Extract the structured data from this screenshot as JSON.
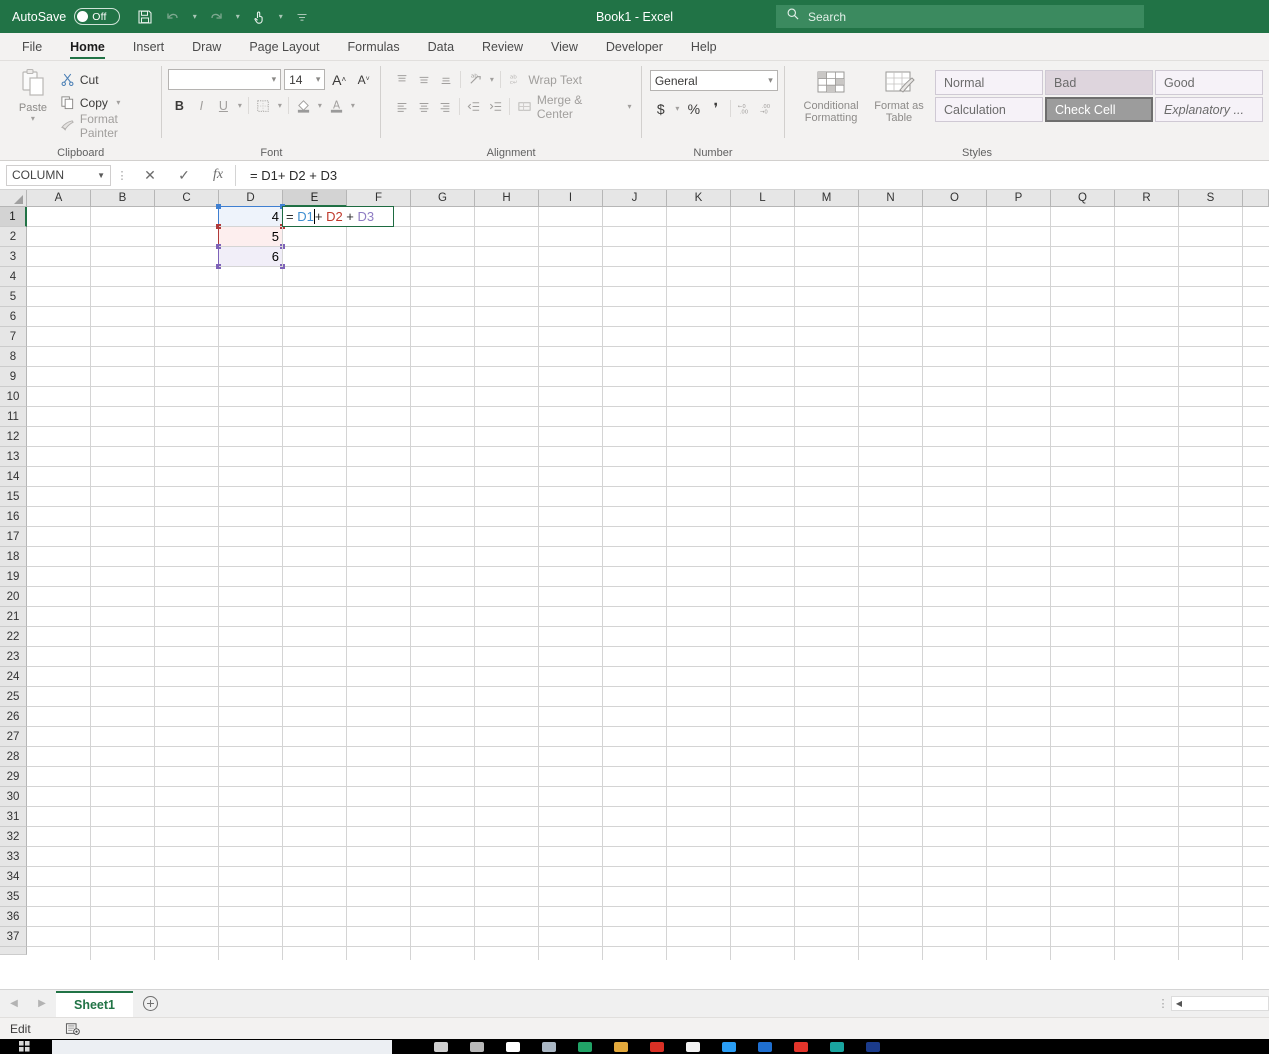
{
  "titlebar": {
    "autosave_label": "AutoSave",
    "autosave_state": "Off",
    "save_icon": "save-icon",
    "undo_icon": "undo-icon",
    "redo_icon": "redo-icon",
    "touch_icon": "touch-mode-icon",
    "customize_icon": "customize-quick-access-toolbar-icon",
    "title": "Book1  -  Excel",
    "search_placeholder": "Search",
    "search_icon": "search-icon",
    "accent_color": "#217346"
  },
  "ribbon_tabs": [
    {
      "label": "File",
      "active": false
    },
    {
      "label": "Home",
      "active": true
    },
    {
      "label": "Insert",
      "active": false
    },
    {
      "label": "Draw",
      "active": false
    },
    {
      "label": "Page Layout",
      "active": false
    },
    {
      "label": "Formulas",
      "active": false
    },
    {
      "label": "Data",
      "active": false
    },
    {
      "label": "Review",
      "active": false
    },
    {
      "label": "View",
      "active": false
    },
    {
      "label": "Developer",
      "active": false
    },
    {
      "label": "Help",
      "active": false
    }
  ],
  "ribbon": {
    "clipboard": {
      "group_label": "Clipboard",
      "paste_label": "Paste",
      "cut_label": "Cut",
      "copy_label": "Copy",
      "format_painter_label": "Format Painter"
    },
    "font": {
      "group_label": "Font",
      "font_name_value": "",
      "font_size_value": "14",
      "grow_font_label": "A",
      "shrink_font_label": "A",
      "bold_label": "B",
      "italic_label": "I",
      "underline_label": "U"
    },
    "alignment": {
      "group_label": "Alignment",
      "wrap_text_label": "Wrap Text",
      "merge_center_label": "Merge & Center"
    },
    "number": {
      "group_label": "Number",
      "format_value": "General",
      "currency_label": "$",
      "percent_label": "%",
      "comma_label": "‰"
    },
    "styles": {
      "group_label": "Styles",
      "conditional_formatting_label": "Conditional Formatting",
      "format_as_table_label": "Format as Table",
      "gallery": [
        "Normal",
        "Bad",
        "Good",
        "Calculation",
        "Check Cell",
        "Explanatory ..."
      ]
    }
  },
  "formula_bar": {
    "name_box_value": "COLUMN",
    "cancel_label": "✕",
    "enter_label": "✓",
    "fx_label": "fx",
    "formula_value": "= D1+ D2 + D3"
  },
  "grid": {
    "columns": [
      "A",
      "B",
      "C",
      "D",
      "E",
      "F",
      "G",
      "H",
      "I",
      "J",
      "K",
      "L",
      "M",
      "N",
      "O",
      "P",
      "Q",
      "R",
      "S"
    ],
    "selected_column": "E",
    "rows": [
      1,
      2,
      3,
      4,
      5,
      6,
      7,
      8,
      9,
      10,
      11,
      12,
      13,
      14,
      15,
      16,
      17,
      18,
      19,
      20,
      21,
      22,
      23,
      24,
      25,
      26,
      27,
      28,
      29,
      30,
      31,
      32,
      33,
      34,
      35,
      36,
      37
    ],
    "selected_row": 1,
    "cell_values": [
      {
        "ref": "D1",
        "col": 3,
        "row": 1,
        "value": "4"
      },
      {
        "ref": "D2",
        "col": 3,
        "row": 2,
        "value": "5"
      },
      {
        "ref": "D3",
        "col": 3,
        "row": 3,
        "value": "6"
      }
    ],
    "active_cell": "E1",
    "edit_tokens": [
      {
        "text": "= ",
        "color": "#2b2b2b"
      },
      {
        "text": "D1",
        "color": "#3f8fd1"
      },
      {
        "text": "caret",
        "color": "#000000"
      },
      {
        "text": "+ ",
        "color": "#2b2b2b"
      },
      {
        "text": "D2",
        "color": "#c0392b"
      },
      {
        "text": " + ",
        "color": "#2b2b2b"
      },
      {
        "text": "D3",
        "color": "#8e7cc3"
      }
    ],
    "reference_colors": {
      "D1": "#3f7fd1",
      "D2": "#b03a3a",
      "D3": "#7e62b8"
    }
  },
  "sheetbar": {
    "prev_icon": "nav-prev-icon",
    "next_icon": "nav-next-icon",
    "tabs": [
      {
        "label": "Sheet1",
        "active": true
      }
    ],
    "add_sheet_label": "+",
    "scroll_left_icon": "scroll-left-icon"
  },
  "statusbar": {
    "mode": "Edit",
    "macro_icon": "record-macro-icon"
  },
  "taskbar": {
    "start_icon": "windows-start-icon",
    "search_placeholder": "",
    "icons": [
      "task-view-icon",
      "widgets-icon",
      "camera-icon",
      "file-icon",
      "excel-icon",
      "folder-icon",
      "app-red-icon",
      "app-white-icon",
      "app-blue-icon",
      "app-blue2-icon",
      "app-red2-icon",
      "app-teal-icon",
      "app-navy-icon"
    ]
  }
}
